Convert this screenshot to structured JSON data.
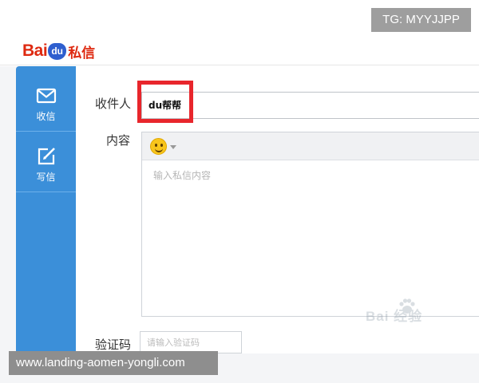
{
  "overlay": {
    "tg_badge": "TG: MYYJJPP",
    "url_banner": "www.landing-aomen-yongli.com"
  },
  "header": {
    "logo_bai": "Bai",
    "logo_du": "du",
    "logo_text": "私信"
  },
  "sidebar": {
    "items": [
      {
        "label": "收信",
        "icon": "envelope-icon"
      },
      {
        "label": "写信",
        "icon": "edit-icon"
      }
    ]
  },
  "form": {
    "recipient_label": "收件人",
    "recipient_value": "du帮帮",
    "content_label": "内容",
    "content_placeholder": "输入私信内容",
    "captcha_label": "验证码",
    "captcha_placeholder": "请输入验证码"
  },
  "watermark": {
    "text": "Bai 经验"
  },
  "colors": {
    "sidebar": "#3b8fd9",
    "brand_red": "#de2910",
    "brand_blue": "#2e5fcf",
    "highlight": "#e8262c"
  }
}
